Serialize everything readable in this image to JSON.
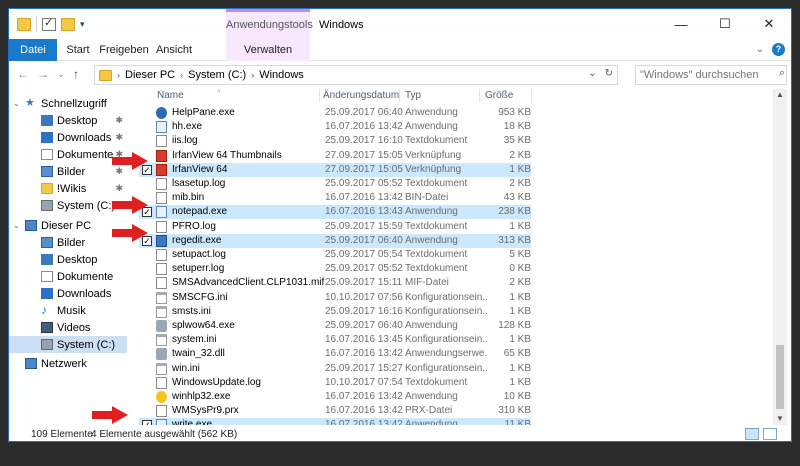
{
  "titlebar": {
    "context_group": "Anwendungstools",
    "title": "Windows",
    "minimize_glyph": "—",
    "maximize_glyph": "☐",
    "close_glyph": "✕"
  },
  "ribbon": {
    "tabs": [
      {
        "label": "Datei"
      },
      {
        "label": "Start"
      },
      {
        "label": "Freigeben"
      },
      {
        "label": "Ansicht"
      },
      {
        "label": "Verwalten"
      }
    ],
    "expand_glyph": "⌄",
    "help_glyph": "?"
  },
  "address": {
    "crumbs": [
      "Dieser PC",
      "System (C:)",
      "Windows"
    ],
    "search_placeholder": "\"Windows\" durchsuchen"
  },
  "nav": {
    "items": [
      {
        "label": "Schnellzugriff",
        "icon": "star-icon"
      },
      {
        "label": "Desktop",
        "icon": "desktop-icon"
      },
      {
        "label": "Downloads",
        "icon": "download-icon"
      },
      {
        "label": "Dokumente",
        "icon": "documents-icon"
      },
      {
        "label": "Bilder",
        "icon": "pictures-icon"
      },
      {
        "label": "!Wikis",
        "icon": "folder-icon"
      },
      {
        "label": "System (C:)",
        "icon": "drive-icon"
      },
      {
        "label": "Dieser PC",
        "icon": "computer-icon"
      },
      {
        "label": "Bilder",
        "icon": "pictures-icon"
      },
      {
        "label": "Desktop",
        "icon": "desktop-icon"
      },
      {
        "label": "Dokumente",
        "icon": "documents-icon"
      },
      {
        "label": "Downloads",
        "icon": "download-icon"
      },
      {
        "label": "Musik",
        "icon": "music-icon"
      },
      {
        "label": "Videos",
        "icon": "video-icon"
      },
      {
        "label": "System (C:)",
        "icon": "drive-icon"
      },
      {
        "label": "Netzwerk",
        "icon": "network-icon"
      }
    ]
  },
  "columns": {
    "name": "Name",
    "date": "Änderungsdatum",
    "type": "Typ",
    "size": "Größe"
  },
  "files": [
    {
      "name": "HelpPane.exe",
      "date": "25.09.2017 06:40",
      "type": "Anwendung",
      "size": "953 KB",
      "icon": "help-icon",
      "checked": false
    },
    {
      "name": "hh.exe",
      "date": "16.07.2016 13:42",
      "type": "Anwendung",
      "size": "18 KB",
      "icon": "exe-icon",
      "checked": false
    },
    {
      "name": "iis.log",
      "date": "25.09.2017 16:10",
      "type": "Textdokument",
      "size": "35 KB",
      "icon": "doc-icon",
      "checked": false
    },
    {
      "name": "IrfanView 64 Thumbnails",
      "date": "27.09.2017 15:05",
      "type": "Verknüpfung",
      "size": "2 KB",
      "icon": "shortcut-icon",
      "checked": false
    },
    {
      "name": "IrfanView 64",
      "date": "27.09.2017 15:05",
      "type": "Verknüpfung",
      "size": "1 KB",
      "icon": "shortcut-icon",
      "checked": true
    },
    {
      "name": "lsasetup.log",
      "date": "25.09.2017 05:52",
      "type": "Textdokument",
      "size": "2 KB",
      "icon": "doc-icon",
      "checked": false
    },
    {
      "name": "mib.bin",
      "date": "16.07.2016 13:42",
      "type": "BIN-Datei",
      "size": "43 KB",
      "icon": "doc-icon",
      "checked": false
    },
    {
      "name": "notepad.exe",
      "date": "16.07.2016 13:43",
      "type": "Anwendung",
      "size": "238 KB",
      "icon": "notepad-icon",
      "checked": true
    },
    {
      "name": "PFRO.log",
      "date": "25.09.2017 15:59",
      "type": "Textdokument",
      "size": "1 KB",
      "icon": "doc-icon",
      "checked": false
    },
    {
      "name": "regedit.exe",
      "date": "25.09.2017 06:40",
      "type": "Anwendung",
      "size": "313 KB",
      "icon": "regedit-icon",
      "checked": true
    },
    {
      "name": "setupact.log",
      "date": "25.09.2017 05:54",
      "type": "Textdokument",
      "size": "5 KB",
      "icon": "doc-icon",
      "checked": false
    },
    {
      "name": "setuperr.log",
      "date": "25.09.2017 05:52",
      "type": "Textdokument",
      "size": "0 KB",
      "icon": "doc-icon",
      "checked": false
    },
    {
      "name": "SMSAdvancedClient.CLP1031.mif",
      "date": "25.09.2017 15:11",
      "type": "MIF-Datei",
      "size": "2 KB",
      "icon": "doc-icon",
      "checked": false
    },
    {
      "name": "SMSCFG.ini",
      "date": "10.10.2017 07:56",
      "type": "Konfigurationsein...",
      "size": "1 KB",
      "icon": "ini-icon",
      "checked": false
    },
    {
      "name": "smsts.ini",
      "date": "25.09.2017 16:16",
      "type": "Konfigurationsein...",
      "size": "1 KB",
      "icon": "ini-icon",
      "checked": false
    },
    {
      "name": "splwow64.exe",
      "date": "25.09.2017 06:40",
      "type": "Anwendung",
      "size": "128 KB",
      "icon": "printer-icon",
      "checked": false
    },
    {
      "name": "system.ini",
      "date": "16.07.2016 13:45",
      "type": "Konfigurationsein...",
      "size": "1 KB",
      "icon": "ini-icon",
      "checked": false
    },
    {
      "name": "twain_32.dll",
      "date": "16.07.2016 13:42",
      "type": "Anwendungserwe...",
      "size": "65 KB",
      "icon": "gear-icon",
      "checked": false
    },
    {
      "name": "win.ini",
      "date": "25.09.2017 15:27",
      "type": "Konfigurationsein...",
      "size": "1 KB",
      "icon": "ini-icon",
      "checked": false
    },
    {
      "name": "WindowsUpdate.log",
      "date": "10.10.2017 07:54",
      "type": "Textdokument",
      "size": "1 KB",
      "icon": "doc-icon",
      "checked": false
    },
    {
      "name": "winhlp32.exe",
      "date": "16.07.2016 13:42",
      "type": "Anwendung",
      "size": "10 KB",
      "icon": "helpq-icon",
      "checked": false
    },
    {
      "name": "WMSysPr9.prx",
      "date": "16.07.2016 13:42",
      "type": "PRX-Datei",
      "size": "310 KB",
      "icon": "doc-icon",
      "checked": false
    },
    {
      "name": "write.exe",
      "date": "16.07.2016 13:42",
      "type": "Anwendung",
      "size": "11 KB",
      "icon": "write-icon",
      "checked": true
    }
  ],
  "status": {
    "count": "109 Elemente",
    "selection": "4 Elemente ausgewählt (562 KB)"
  },
  "colors": {
    "accent": "#1979ca",
    "selection": "#cce8ff",
    "annotation_arrow": "#e02020"
  }
}
